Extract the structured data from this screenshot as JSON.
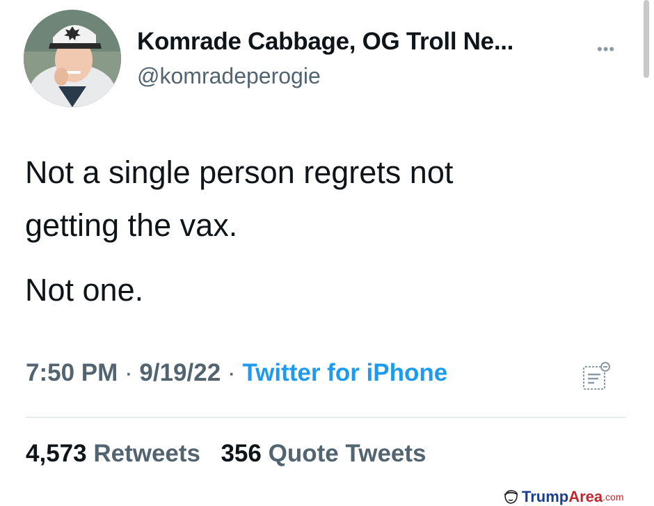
{
  "tweet": {
    "display_name": "Komrade Cabbage, OG Troll Ne...",
    "handle": "@komradeperogie",
    "more_icon": "more-icon",
    "lines": [
      "Not a single person regrets not",
      "getting the vax.",
      "Not one."
    ],
    "time": "7:50 PM",
    "date": "9/19/22",
    "source": "Twitter for iPhone",
    "analytics_icon": "analytics-icon",
    "retweets_count": "4,573",
    "retweets_label": "Retweets",
    "quotes_count": "356",
    "quotes_label": "Quote Tweets"
  },
  "watermark": {
    "part1": "Trump",
    "part2": "Area",
    "suffix": ".com"
  },
  "colors": {
    "text": "#0f1419",
    "secondary": "#536471",
    "link": "#1d9bf0",
    "divider": "#d6dbe0"
  }
}
